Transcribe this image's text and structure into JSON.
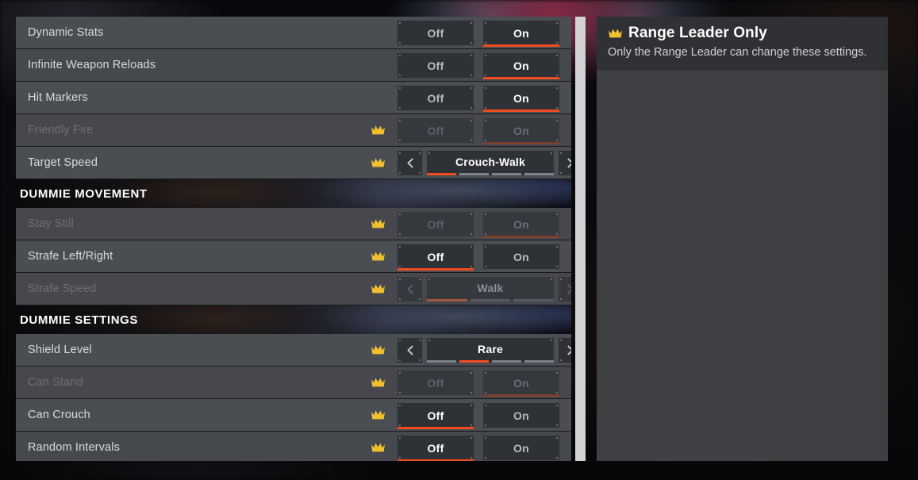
{
  "theme": {
    "accent": "#f04b1e",
    "crown": "#f0c030",
    "row_bg": "#4a4d52",
    "panel_bg": "#3e4044",
    "button_bg": "#2e3136",
    "text": "#d8dade",
    "text_disabled": "#6e7076"
  },
  "left_panel": {
    "scrollbar": {
      "name": "vertical-scrollbar"
    },
    "groups": [
      {
        "type": "rows",
        "rows": [
          {
            "label": "Dynamic Stats",
            "crown": false,
            "disabled": false,
            "control": "toggle",
            "options": [
              "Off",
              "On"
            ],
            "selected": "On"
          },
          {
            "label": "Infinite Weapon Reloads",
            "crown": false,
            "disabled": false,
            "control": "toggle",
            "options": [
              "Off",
              "On"
            ],
            "selected": "On"
          },
          {
            "label": "Hit Markers",
            "crown": false,
            "disabled": false,
            "control": "toggle",
            "options": [
              "Off",
              "On"
            ],
            "selected": "On"
          },
          {
            "label": "Friendly Fire",
            "crown": true,
            "disabled": true,
            "control": "toggle",
            "options": [
              "Off",
              "On"
            ],
            "selected": "On"
          },
          {
            "label": "Target Speed",
            "crown": true,
            "disabled": false,
            "control": "stepper",
            "value": "Crouch-Walk",
            "segments": 4,
            "active_segment": 1,
            "prev_icon": "chevron-left-icon",
            "next_icon": "chevron-right-icon"
          }
        ]
      },
      {
        "type": "section",
        "title": "DUMMIE MOVEMENT"
      },
      {
        "type": "rows",
        "rows": [
          {
            "label": "Stay Still",
            "crown": true,
            "disabled": true,
            "control": "toggle",
            "options": [
              "Off",
              "On"
            ],
            "selected": "On"
          },
          {
            "label": "Strafe Left/Right",
            "crown": true,
            "disabled": false,
            "control": "toggle",
            "options": [
              "Off",
              "On"
            ],
            "selected": "Off"
          },
          {
            "label": "Strafe Speed",
            "crown": true,
            "disabled": true,
            "control": "stepper",
            "value": "Walk",
            "segments": 3,
            "active_segment": 1,
            "prev_icon": "chevron-left-icon",
            "next_icon": "chevron-right-icon"
          }
        ]
      },
      {
        "type": "section",
        "title": "DUMMIE SETTINGS"
      },
      {
        "type": "rows",
        "rows": [
          {
            "label": "Shield Level",
            "crown": true,
            "disabled": false,
            "control": "stepper",
            "value": "Rare",
            "segments": 4,
            "active_segment": 2,
            "prev_icon": "chevron-left-icon",
            "next_icon": "chevron-right-icon"
          },
          {
            "label": "Can Stand",
            "crown": true,
            "disabled": true,
            "control": "toggle",
            "options": [
              "Off",
              "On"
            ],
            "selected": "On"
          },
          {
            "label": "Can Crouch",
            "crown": true,
            "disabled": false,
            "control": "toggle",
            "options": [
              "Off",
              "On"
            ],
            "selected": "Off"
          },
          {
            "label": "Random Intervals",
            "crown": true,
            "disabled": false,
            "control": "toggle",
            "options": [
              "Off",
              "On"
            ],
            "selected": "Off"
          }
        ]
      }
    ]
  },
  "right_panel": {
    "crown_icon": "crown-icon",
    "title": "Range Leader Only",
    "description": "Only the Range Leader can change these settings."
  }
}
